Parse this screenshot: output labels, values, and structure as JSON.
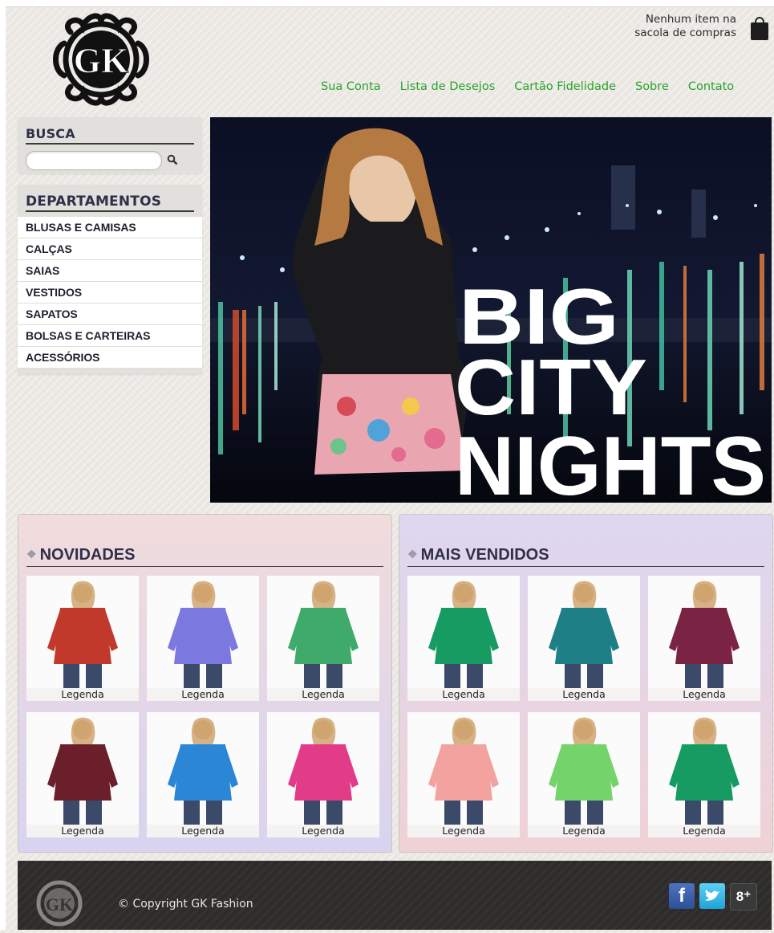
{
  "header": {
    "logo_text": "GK",
    "cart_status": "Nenhum item na sacola de compras",
    "nav": [
      "Sua Conta",
      "Lista de Desejos",
      "Cartão Fidelidade",
      "Sobre",
      "Contato"
    ]
  },
  "sidebar": {
    "search_title": "BUSCA",
    "search_value": "",
    "departments_title": "DEPARTAMENTOS",
    "departments": [
      "BLUSAS E CAMISAS",
      "CALÇAS",
      "SAIAS",
      "VESTIDOS",
      "SAPATOS",
      "BOLSAS E CARTEIRAS",
      "ACESSÓRIOS"
    ]
  },
  "hero": {
    "lines": [
      "BIG",
      "CITY",
      "NIGHTS"
    ]
  },
  "novidades": {
    "title": "NOVIDADES",
    "items": [
      {
        "caption": "Legenda",
        "color": "#c0392b"
      },
      {
        "caption": "Legenda",
        "color": "#7b79e0"
      },
      {
        "caption": "Legenda",
        "color": "#3faa6a"
      },
      {
        "caption": "Legenda",
        "color": "#6b1f2a"
      },
      {
        "caption": "Legenda",
        "color": "#2b86d6"
      },
      {
        "caption": "Legenda",
        "color": "#e23b88"
      }
    ]
  },
  "mais_vendidos": {
    "title": "MAIS VENDIDOS",
    "items": [
      {
        "caption": "Legenda",
        "color": "#169b62"
      },
      {
        "caption": "Legenda",
        "color": "#1e7f86"
      },
      {
        "caption": "Legenda",
        "color": "#7a2343"
      },
      {
        "caption": "Legenda",
        "color": "#f2a3a0"
      },
      {
        "caption": "Legenda",
        "color": "#74d36a"
      },
      {
        "caption": "Legenda",
        "color": "#169b62"
      }
    ]
  },
  "footer": {
    "copyright": "© Copyright GK Fashion",
    "social": [
      "facebook-icon",
      "twitter-icon",
      "google-plus-icon"
    ],
    "google_plus_label": "8⁺",
    "facebook_label": "f"
  }
}
